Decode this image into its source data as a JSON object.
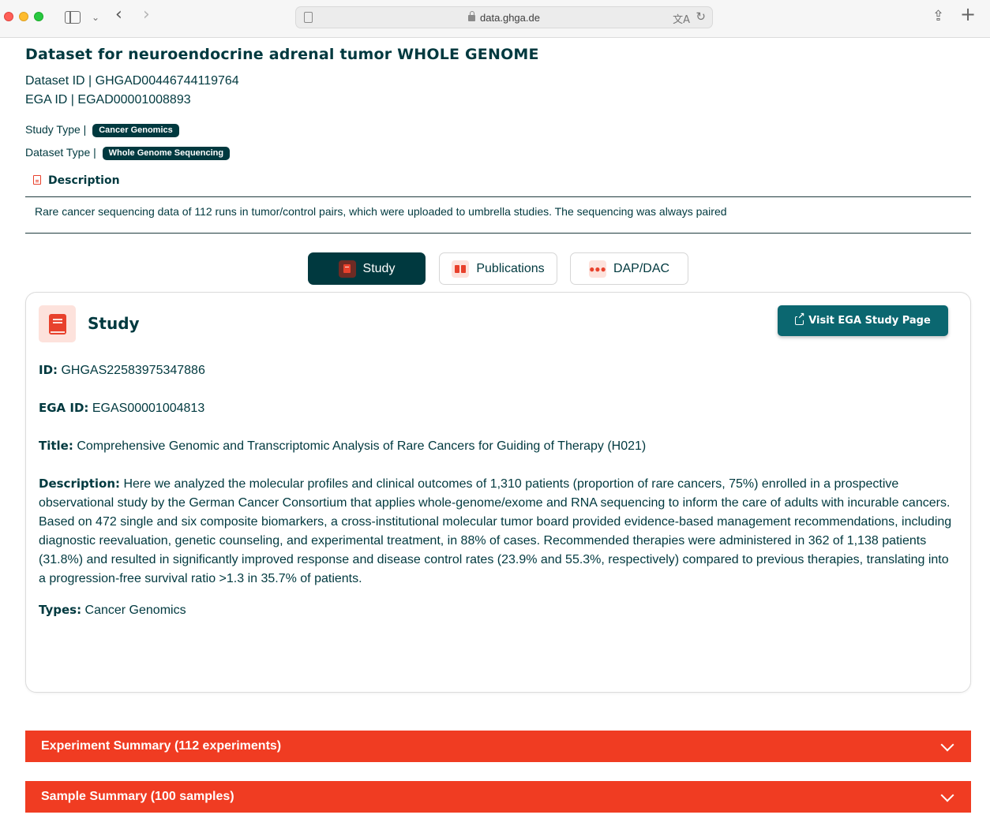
{
  "browser": {
    "url": "data.ghga.de"
  },
  "dataset": {
    "title": "Dataset for neuroendocrine adrenal tumor WHOLE GENOME",
    "dataset_id_line": "Dataset ID | GHGAD00446744119764",
    "ega_id_line": "EGA ID | EGAD00001008893",
    "study_type_label": "Study Type |",
    "study_type_value": "Cancer Genomics",
    "dataset_type_label": "Dataset Type |",
    "dataset_type_value": "Whole Genome Sequencing",
    "description_heading": "Description",
    "description_text": "Rare cancer sequencing data of 112 runs in tumor/control pairs, which were uploaded to umbrella studies. The sequencing was always paired"
  },
  "tabs": [
    {
      "label": "Study",
      "active": true
    },
    {
      "label": "Publications",
      "active": false
    },
    {
      "label": "DAP/DAC",
      "active": false
    }
  ],
  "study_card": {
    "title": "Study",
    "visit_button": "Visit EGA Study Page",
    "id_label": "ID:",
    "id_value": "GHGAS22583975347886",
    "ega_label": "EGA ID:",
    "ega_value": "EGAS00001004813",
    "title_label": "Title:",
    "title_value": "Comprehensive Genomic and Transcriptomic Analysis of Rare Cancers for Guiding of Therapy (H021)",
    "description_label": "Description:",
    "description_value": "Here we analyzed the molecular profiles and clinical outcomes of 1,310 patients (proportion of rare cancers, 75%) enrolled in a prospective observational study by the German Cancer Consortium that applies whole-genome/exome and RNA sequencing to inform the care of adults with incurable cancers. Based on 472 single and six composite biomarkers, a cross-institutional molecular tumor board provided evidence-based management recommendations, including diagnostic reevaluation, genetic counseling, and experimental treatment, in 88% of cases. Recommended therapies were administered in 362 of 1,138 patients (31.8%) and resulted in significantly improved response and disease control rates (23.9% and 55.3%, respectively) compared to previous therapies, translating into a progression-free survival ratio >1.3 in 35.7% of patients.",
    "types_label": "Types:",
    "types_value": "Cancer Genomics"
  },
  "summaries": {
    "experiment": "Experiment Summary (112 experiments)",
    "sample": "Sample Summary (100 samples)"
  },
  "colors": {
    "brand_dark": "#00393f",
    "accent_red": "#f03c22",
    "teal_button": "#0b6770",
    "icon_bg": "#fde2dc"
  }
}
